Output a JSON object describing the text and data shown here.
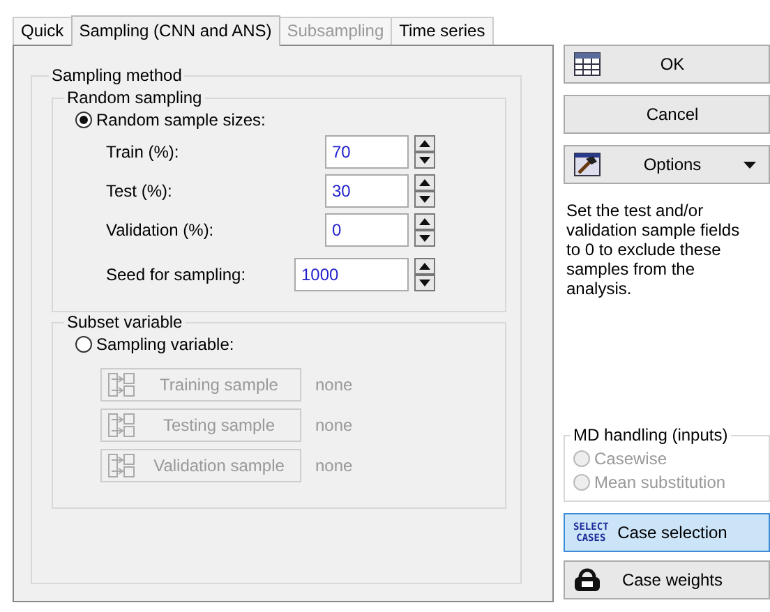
{
  "tabs": [
    {
      "label": "Quick",
      "selected": false,
      "disabled": false
    },
    {
      "label": "Sampling (CNN and ANS)",
      "selected": true,
      "disabled": false
    },
    {
      "label": "Subsampling",
      "selected": false,
      "disabled": true
    },
    {
      "label": "Time series",
      "selected": false,
      "disabled": false
    }
  ],
  "sampling_method": {
    "title": "Sampling method",
    "random_sampling": {
      "title": "Random sampling",
      "option": {
        "label": "Random sample sizes:",
        "selected": true
      },
      "fields": [
        {
          "label": "Train (%):",
          "value": "70",
          "kind": "short"
        },
        {
          "label": "Test (%):",
          "value": "30",
          "kind": "short"
        },
        {
          "label": "Validation (%):",
          "value": "0",
          "kind": "short"
        },
        {
          "label": "Seed for sampling:",
          "value": "1000",
          "kind": "wide"
        }
      ]
    },
    "subset_variable": {
      "title": "Subset variable",
      "option": {
        "label": "Sampling variable:",
        "selected": false
      },
      "buttons": [
        {
          "label": "Training sample",
          "value": "none",
          "disabled": true
        },
        {
          "label": "Testing sample",
          "value": "none",
          "disabled": true
        },
        {
          "label": "Validation sample",
          "value": "none",
          "disabled": true
        }
      ]
    }
  },
  "buttons": [
    {
      "label": "OK",
      "kind": "confirm",
      "dropdown": false
    },
    {
      "label": "Cancel",
      "kind": "cancel",
      "dropdown": false
    },
    {
      "label": "Options",
      "kind": "options",
      "dropdown": true
    }
  ],
  "description": "Set the test and/or validation sample fields to 0 to exclude these samples from the analysis.",
  "md_handling": {
    "title": "MD handling (inputs)",
    "options": [
      {
        "label": "Casewise",
        "selected": false,
        "disabled": true
      },
      {
        "label": "Mean substitution",
        "selected": false,
        "disabled": true
      }
    ]
  },
  "bottom_buttons": [
    {
      "label": "Case selection",
      "kind": "selection",
      "icon_lines": [
        "SELECT",
        "CASES"
      ],
      "selected": true
    },
    {
      "label": "Case weights",
      "kind": "weights",
      "selected": false
    }
  ]
}
